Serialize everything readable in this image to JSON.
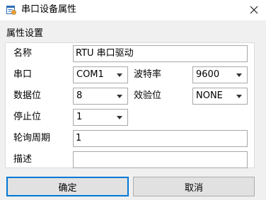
{
  "window": {
    "title": "串口设备属性",
    "icon": "app-properties-icon"
  },
  "group": {
    "title": "属性设置"
  },
  "fields": {
    "name": {
      "label": "名称",
      "value": "RTU 串口驱动"
    },
    "port": {
      "label": "串口",
      "value": "COM1"
    },
    "baud": {
      "label": "波特率",
      "value": "9600"
    },
    "databits": {
      "label": "数据位",
      "value": "8"
    },
    "parity": {
      "label": "效验位",
      "value": "NONE"
    },
    "stopbits": {
      "label": "停止位",
      "value": "1"
    },
    "poll": {
      "label": "轮询周期",
      "value": "1"
    },
    "desc": {
      "label": "描述",
      "value": ""
    }
  },
  "buttons": {
    "ok": "确定",
    "cancel": "取消"
  },
  "colors": {
    "accent": "#0078d7",
    "window_bg": "#f0f0f0"
  }
}
